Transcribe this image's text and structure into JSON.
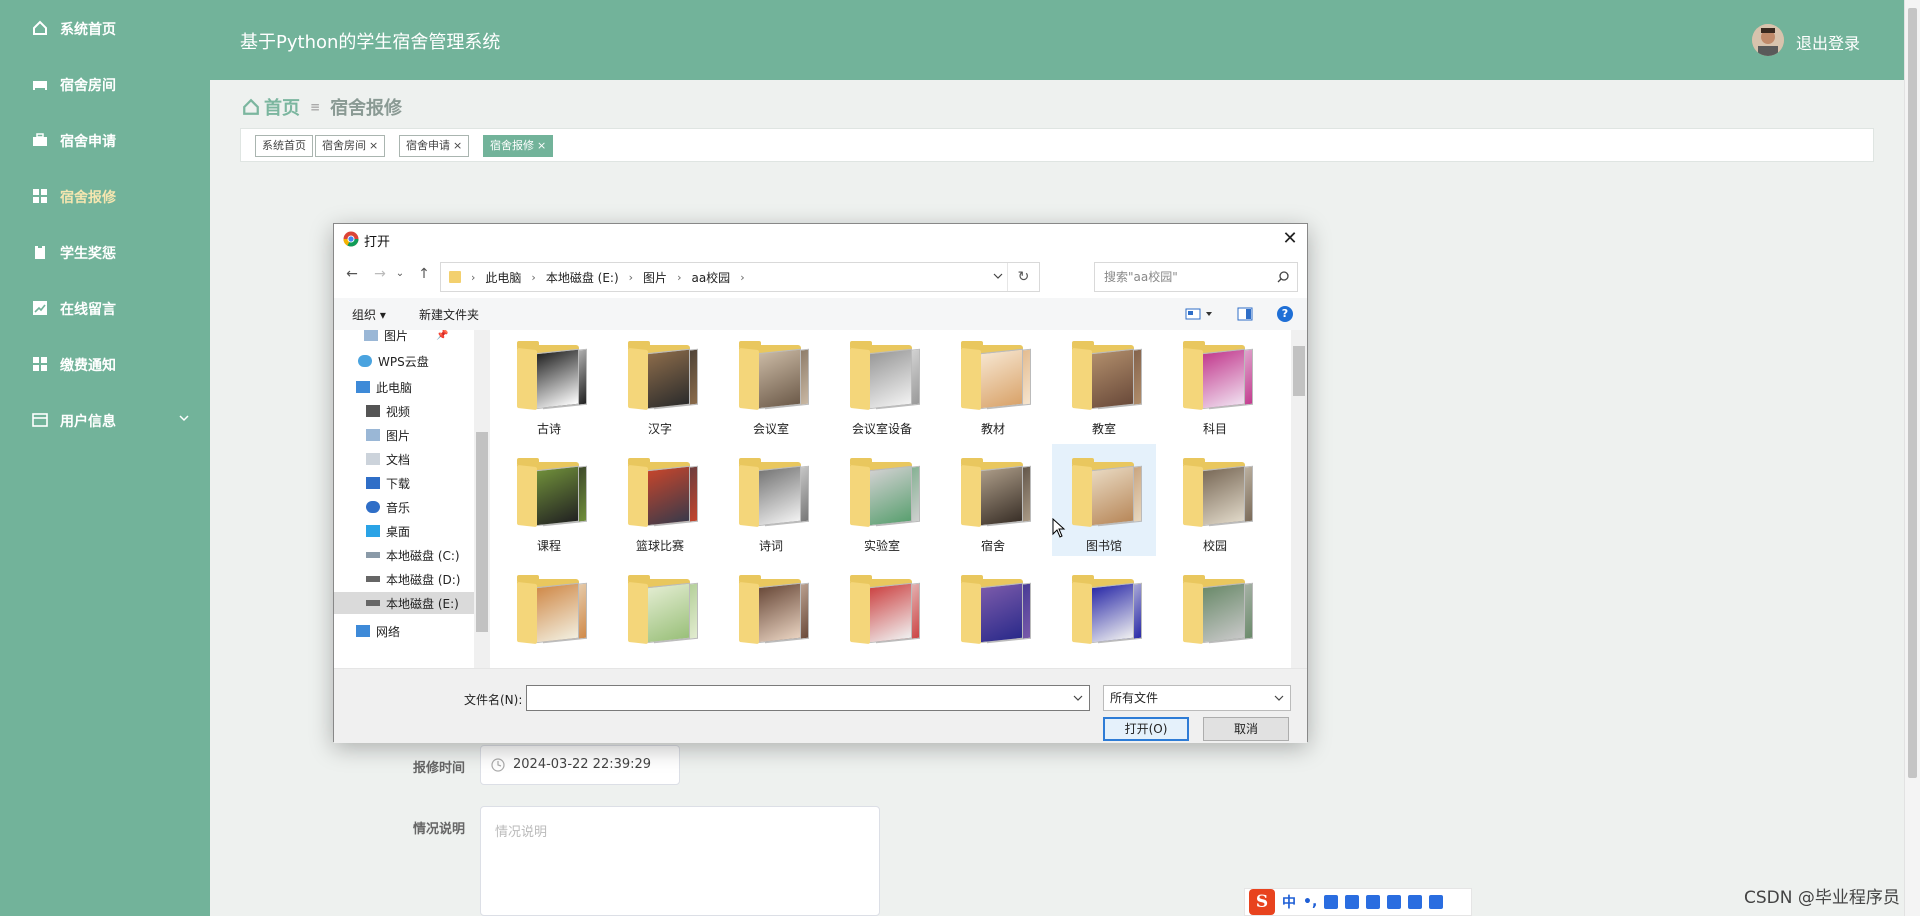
{
  "sidebar": {
    "items": [
      {
        "label": "系统首页",
        "icon": "home-icon"
      },
      {
        "label": "宿舍房间",
        "icon": "bed-icon"
      },
      {
        "label": "宿舍申请",
        "icon": "briefcase-icon"
      },
      {
        "label": "宿舍报修",
        "icon": "grid-icon"
      },
      {
        "label": "学生奖惩",
        "icon": "clipboard-icon"
      },
      {
        "label": "在线留言",
        "icon": "chart-icon"
      },
      {
        "label": "缴费通知",
        "icon": "grid-icon"
      },
      {
        "label": "用户信息",
        "icon": "card-icon"
      }
    ]
  },
  "header": {
    "title": "基于Python的学生宿舍管理系统",
    "logout": "退出登录"
  },
  "breadcrumb": {
    "home": "首页",
    "current": "宿舍报修"
  },
  "tags": [
    {
      "label": "系统首页",
      "closable": false
    },
    {
      "label": "宿舍房间",
      "closable": true
    },
    {
      "label": "宿舍申请",
      "closable": true
    },
    {
      "label": "宿舍报修",
      "closable": true
    }
  ],
  "tag_close": "×",
  "form": {
    "time_label": "报修时间",
    "time_value": "2024-03-22 22:39:29",
    "desc_label": "情况说明",
    "desc_placeholder": "情况说明"
  },
  "dialog": {
    "title": "打开",
    "close": "✕",
    "path": [
      "此电脑",
      "本地磁盘 (E:)",
      "图片",
      "aa校园"
    ],
    "search_placeholder": "搜索\"aa校园\"",
    "organize": "组织 ▾",
    "new_folder": "新建文件夹",
    "help": "?",
    "tree": [
      {
        "label": "图片",
        "icon": "pictures-icon"
      },
      {
        "label": "WPS云盘",
        "icon": "cloud-icon"
      },
      {
        "label": "此电脑",
        "icon": "computer-icon"
      },
      {
        "label": "视频",
        "icon": "video-icon"
      },
      {
        "label": "图片",
        "icon": "pictures-icon"
      },
      {
        "label": "文档",
        "icon": "document-icon"
      },
      {
        "label": "下载",
        "icon": "download-icon"
      },
      {
        "label": "音乐",
        "icon": "music-icon"
      },
      {
        "label": "桌面",
        "icon": "desktop-icon"
      },
      {
        "label": "本地磁盘 (C:)",
        "icon": "drive-icon"
      },
      {
        "label": "本地磁盘 (D:)",
        "icon": "drive-icon"
      },
      {
        "label": "本地磁盘 (E:)",
        "icon": "drive-icon"
      },
      {
        "label": "网络",
        "icon": "network-icon"
      }
    ],
    "folders": [
      "古诗",
      "汉字",
      "会议室",
      "会议室设备",
      "教材",
      "教室",
      "科目",
      "课程",
      "篮球比赛",
      "诗词",
      "实验室",
      "宿舍",
      "图书馆",
      "校园",
      "",
      "",
      "",
      "",
      "",
      "",
      ""
    ],
    "filename_label": "文件名(N):",
    "filename_value": "",
    "filetype": "所有文件",
    "open_button": "打开(O)",
    "cancel_button": "取消"
  },
  "ime": {
    "logo": "S",
    "mode": "中",
    "punct": "•,"
  },
  "watermark": "CSDN @毕业程序员",
  "colors": {
    "sidebar": "#72b39a",
    "accent": "#72b39a",
    "dialog_primary": "#2e7cd6"
  }
}
